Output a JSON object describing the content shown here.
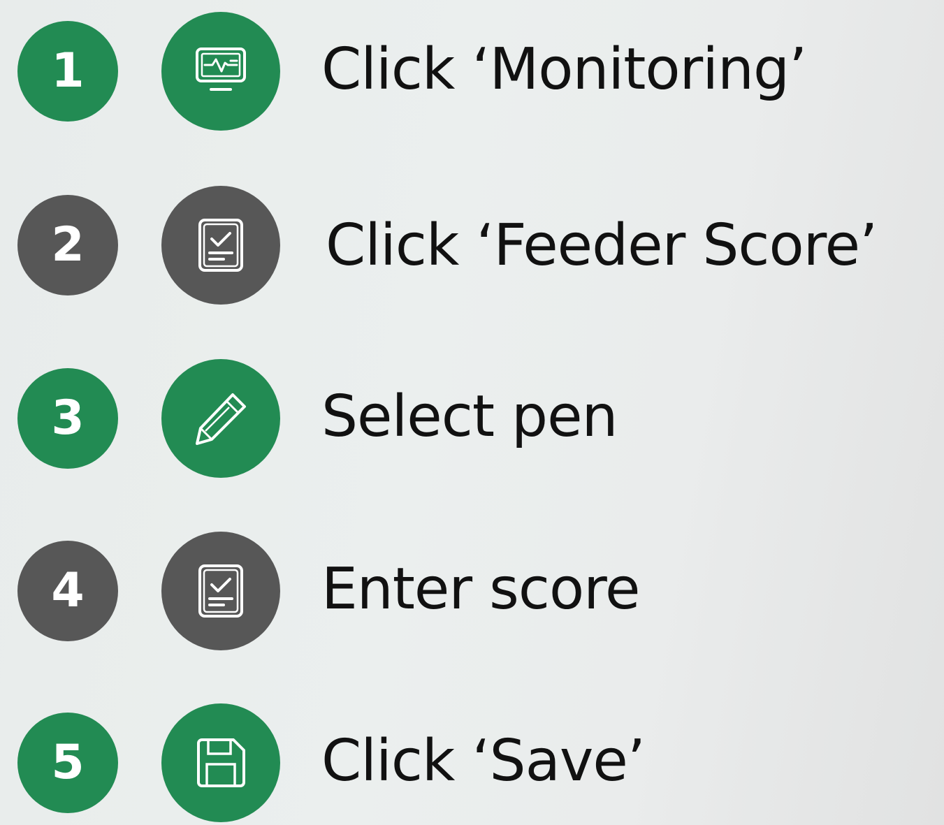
{
  "colors": {
    "green": "#228b53",
    "grey": "#575757",
    "text": "#111111",
    "background": "#eaeeed"
  },
  "steps": [
    {
      "number": "1",
      "label": "Click ‘Monitoring’",
      "icon": "monitor-pulse-icon",
      "color": "green"
    },
    {
      "number": "2",
      "label": "Click ‘Feeder Score’",
      "icon": "clipboard-check-icon",
      "color": "grey"
    },
    {
      "number": "3",
      "label": "Select pen",
      "icon": "pencil-icon",
      "color": "green"
    },
    {
      "number": "4",
      "label": "Enter score",
      "icon": "clipboard-check-icon",
      "color": "grey"
    },
    {
      "number": "5",
      "label": "Click ‘Save’",
      "icon": "save-icon",
      "color": "green"
    }
  ]
}
